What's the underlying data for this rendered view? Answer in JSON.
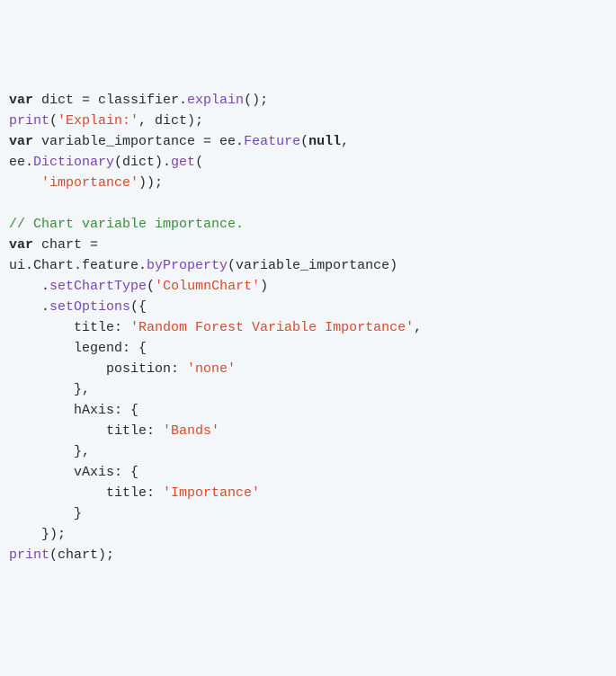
{
  "tokens": [
    {
      "cls": "kw",
      "t": "var"
    },
    {
      "cls": "plain",
      "t": " dict = classifier."
    },
    {
      "cls": "fn",
      "t": "explain"
    },
    {
      "cls": "plain",
      "t": "();"
    },
    {
      "cls": "plain",
      "t": "\n"
    },
    {
      "cls": "fn",
      "t": "print"
    },
    {
      "cls": "plain",
      "t": "("
    },
    {
      "cls": "str",
      "t": "'Explain:'"
    },
    {
      "cls": "plain",
      "t": ", dict);"
    },
    {
      "cls": "plain",
      "t": "\n"
    },
    {
      "cls": "kw",
      "t": "var"
    },
    {
      "cls": "plain",
      "t": " variable_importance = ee."
    },
    {
      "cls": "fn",
      "t": "Feature"
    },
    {
      "cls": "plain",
      "t": "("
    },
    {
      "cls": "kw",
      "t": "null"
    },
    {
      "cls": "plain",
      "t": ","
    },
    {
      "cls": "plain",
      "t": "\n"
    },
    {
      "cls": "plain",
      "t": "ee."
    },
    {
      "cls": "fn",
      "t": "Dictionary"
    },
    {
      "cls": "plain",
      "t": "(dict)."
    },
    {
      "cls": "fn",
      "t": "get"
    },
    {
      "cls": "plain",
      "t": "("
    },
    {
      "cls": "plain",
      "t": "\n"
    },
    {
      "cls": "plain",
      "t": "    "
    },
    {
      "cls": "str",
      "t": "'importance'"
    },
    {
      "cls": "plain",
      "t": "));"
    },
    {
      "cls": "plain",
      "t": "\n"
    },
    {
      "cls": "plain",
      "t": "\n"
    },
    {
      "cls": "cmt",
      "t": "// Chart variable importance."
    },
    {
      "cls": "plain",
      "t": "\n"
    },
    {
      "cls": "kw",
      "t": "var"
    },
    {
      "cls": "plain",
      "t": " chart ="
    },
    {
      "cls": "plain",
      "t": "\n"
    },
    {
      "cls": "plain",
      "t": "ui.Chart.feature."
    },
    {
      "cls": "fn",
      "t": "byProperty"
    },
    {
      "cls": "plain",
      "t": "(variable_importance)"
    },
    {
      "cls": "plain",
      "t": "\n"
    },
    {
      "cls": "plain",
      "t": "    ."
    },
    {
      "cls": "fn",
      "t": "setChartType"
    },
    {
      "cls": "plain",
      "t": "("
    },
    {
      "cls": "str",
      "t": "'ColumnChart'"
    },
    {
      "cls": "plain",
      "t": ")"
    },
    {
      "cls": "plain",
      "t": "\n"
    },
    {
      "cls": "plain",
      "t": "    ."
    },
    {
      "cls": "fn",
      "t": "setOptions"
    },
    {
      "cls": "plain",
      "t": "({"
    },
    {
      "cls": "plain",
      "t": "\n"
    },
    {
      "cls": "plain",
      "t": "        title: "
    },
    {
      "cls": "str",
      "t": "'Random Forest Variable Importance'"
    },
    {
      "cls": "plain",
      "t": ","
    },
    {
      "cls": "plain",
      "t": "\n"
    },
    {
      "cls": "plain",
      "t": "        legend: {"
    },
    {
      "cls": "plain",
      "t": "\n"
    },
    {
      "cls": "plain",
      "t": "            position: "
    },
    {
      "cls": "str",
      "t": "'none'"
    },
    {
      "cls": "plain",
      "t": "\n"
    },
    {
      "cls": "plain",
      "t": "        },"
    },
    {
      "cls": "plain",
      "t": "\n"
    },
    {
      "cls": "plain",
      "t": "        hAxis: {"
    },
    {
      "cls": "plain",
      "t": "\n"
    },
    {
      "cls": "plain",
      "t": "            title: "
    },
    {
      "cls": "str",
      "t": "'Bands'"
    },
    {
      "cls": "plain",
      "t": "\n"
    },
    {
      "cls": "plain",
      "t": "        },"
    },
    {
      "cls": "plain",
      "t": "\n"
    },
    {
      "cls": "plain",
      "t": "        vAxis: {"
    },
    {
      "cls": "plain",
      "t": "\n"
    },
    {
      "cls": "plain",
      "t": "            title: "
    },
    {
      "cls": "str",
      "t": "'Importance'"
    },
    {
      "cls": "plain",
      "t": "\n"
    },
    {
      "cls": "plain",
      "t": "        }"
    },
    {
      "cls": "plain",
      "t": "\n"
    },
    {
      "cls": "plain",
      "t": "    });"
    },
    {
      "cls": "plain",
      "t": "\n"
    },
    {
      "cls": "fn",
      "t": "print"
    },
    {
      "cls": "plain",
      "t": "(chart);"
    }
  ]
}
